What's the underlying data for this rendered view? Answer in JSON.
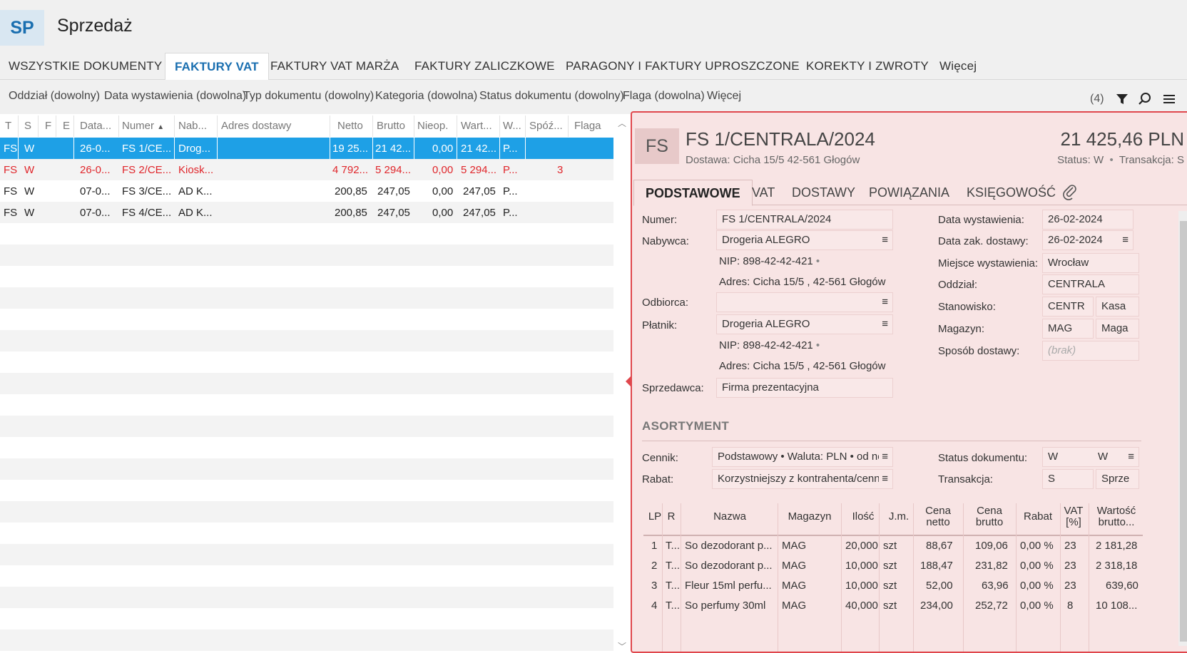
{
  "app": {
    "badge": "SP",
    "title": "Sprzedaż"
  },
  "tabs": [
    {
      "label": "WSZYSTKIE DOKUMENTY"
    },
    {
      "label": "FAKTURY VAT"
    },
    {
      "label": "FAKTURY VAT MARŻA"
    },
    {
      "label": "FAKTURY ZALICZKOWE"
    },
    {
      "label": "PARAGONY I FAKTURY UPROSZCZONE"
    },
    {
      "label": "KOREKTY I ZWROTY"
    },
    {
      "label": "Więcej"
    }
  ],
  "filters": [
    {
      "label": "Oddział (dowolny)"
    },
    {
      "label": "Data wystawienia (dowolna)"
    },
    {
      "label": "Typ dokumentu (dowolny)"
    },
    {
      "label": "Kategoria (dowolna)"
    },
    {
      "label": "Status dokumentu (dowolny)"
    },
    {
      "label": "Flaga (dowolna)"
    },
    {
      "label": "Więcej"
    }
  ],
  "toolbar": {
    "count": "(4)"
  },
  "grid": {
    "columns": [
      "T",
      "S",
      "F",
      "E",
      "Data...",
      "Numer",
      "Nab...",
      "Adres dostawy",
      "Netto",
      "Brutto",
      "Nieop.",
      "Wart...",
      "W...",
      "Spóź...",
      "Flaga"
    ],
    "rows": [
      {
        "t": "FS",
        "s": "W",
        "data": "26-0...",
        "numer": "FS 1/CE...",
        "nab": "Drog...",
        "netto": "19 25...",
        "brutto": "21 42...",
        "nieop": "0,00",
        "wart": "21 42...",
        "w": "P...",
        "spoz": ""
      },
      {
        "t": "FS",
        "s": "W",
        "data": "26-0...",
        "numer": "FS 2/CE...",
        "nab": "Kiosk...",
        "netto": "4 792...",
        "brutto": "5 294...",
        "nieop": "0,00",
        "wart": "5 294...",
        "w": "P...",
        "spoz": "3"
      },
      {
        "t": "FS",
        "s": "W",
        "data": "07-0...",
        "numer": "FS 3/CE...",
        "nab": "AD K...",
        "netto": "200,85",
        "brutto": "247,05",
        "nieop": "0,00",
        "wart": "247,05",
        "w": "P...",
        "spoz": ""
      },
      {
        "t": "FS",
        "s": "W",
        "data": "07-0...",
        "numer": "FS 4/CE...",
        "nab": "AD K...",
        "netto": "200,85",
        "brutto": "247,05",
        "nieop": "0,00",
        "wart": "247,05",
        "w": "P...",
        "spoz": ""
      }
    ]
  },
  "detail": {
    "badge": "FS",
    "title": "FS 1/CENTRALA/2024",
    "subtitle": "Dostawa: Cicha  15/5  42-561 Głogów",
    "amount": "21 425,46 PLN",
    "status_label": "Status:",
    "status_value": "W",
    "transaction_label": "Transakcja:",
    "transaction_value": "S",
    "tabs": [
      "PODSTAWOWE",
      "VAT",
      "DOSTAWY",
      "POWIĄZANIA",
      "KSIĘGOWOŚĆ"
    ],
    "left": {
      "numer_label": "Numer:",
      "numer": "FS 1/CENTRALA/2024",
      "nabywca_label": "Nabywca:",
      "nabywca": "Drogeria ALEGRO",
      "nabywca_nip": "NIP:  898-42-42-421",
      "nabywca_adres": "Adres:  Cicha  15/5 , 42-561 Głogów",
      "odbiorca_label": "Odbiorca:",
      "odbiorca": "",
      "platnik_label": "Płatnik:",
      "platnik": "Drogeria ALEGRO",
      "platnik_nip": "NIP:  898-42-42-421",
      "platnik_adres": "Adres:  Cicha  15/5 , 42-561 Głogów",
      "sprzedawca_label": "Sprzedawca:",
      "sprzedawca": "Firma prezentacyjna"
    },
    "right": {
      "data_wyst_label": "Data wystawienia:",
      "data_wyst": "26-02-2024",
      "data_dost_label": "Data zak. dostawy:",
      "data_dost": "26-02-2024",
      "miejsce_label": "Miejsce wystawienia:",
      "miejsce": "Wrocław",
      "oddzial_label": "Oddział:",
      "oddzial": "CENTRALA",
      "stanowisko_label": "Stanowisko:",
      "stanowisko_code": "CENTR",
      "stanowisko_name": "Kasa",
      "magazyn_label": "Magazyn:",
      "magazyn_code": "MAG",
      "magazyn_name": "Maga",
      "sposob_label": "Sposób dostawy:",
      "sposob": "(brak)"
    },
    "asortyment": {
      "title": "ASORTYMENT",
      "cennik_label": "Cennik:",
      "cennik": "Podstawowy • Waluta: PLN • od ne",
      "rabat_label": "Rabat:",
      "rabat": "Korzystniejszy z kontrahenta/cenn",
      "status_doc_label": "Status dokumentu:",
      "status_doc_code": "W",
      "status_doc_name": "W",
      "transakcja_label": "Transakcja:",
      "transakcja_code": "S",
      "transakcja_name": "Sprze"
    },
    "items": {
      "columns": [
        "LP",
        "R",
        "Nazwa",
        "Magazyn",
        "Ilość",
        "J.m.",
        "Cena netto",
        "Cena brutto",
        "Rabat",
        "VAT [%]",
        "Wartość brutto..."
      ],
      "rows": [
        {
          "lp": "1",
          "r": "T...",
          "nazwa": "So dezodorant p...",
          "mag": "MAG",
          "ilosc": "20,000",
          "jm": "szt",
          "netto": "88,67",
          "brutto": "109,06",
          "rabat": "0,00 %",
          "vat": "23",
          "wartosc": "2 181,28"
        },
        {
          "lp": "2",
          "r": "T...",
          "nazwa": "So dezodorant p...",
          "mag": "MAG",
          "ilosc": "10,000",
          "jm": "szt",
          "netto": "188,47",
          "brutto": "231,82",
          "rabat": "0,00 %",
          "vat": "23",
          "wartosc": "2 318,18"
        },
        {
          "lp": "3",
          "r": "T...",
          "nazwa": "Fleur 15ml perfu...",
          "mag": "MAG",
          "ilosc": "10,000",
          "jm": "szt",
          "netto": "52,00",
          "brutto": "63,96",
          "rabat": "0,00 %",
          "vat": "23",
          "wartosc": "639,60"
        },
        {
          "lp": "4",
          "r": "T...",
          "nazwa": "So perfumy 30ml",
          "mag": "MAG",
          "ilosc": "40,000",
          "jm": "szt",
          "netto": "234,00",
          "brutto": "252,72",
          "rabat": "0,00 %",
          "vat": "8",
          "wartosc": "10 108..."
        }
      ]
    }
  },
  "icons": {
    "filter": "filter-icon",
    "search": "search-icon",
    "menu": "hamburger-icon",
    "attach": "paperclip-icon"
  },
  "colors": {
    "accent": "#1a6fb0",
    "selection": "#1ea0e6",
    "error": "#e0262b",
    "panel_border": "#e0474d",
    "panel_bg": "#f8e4e4"
  }
}
